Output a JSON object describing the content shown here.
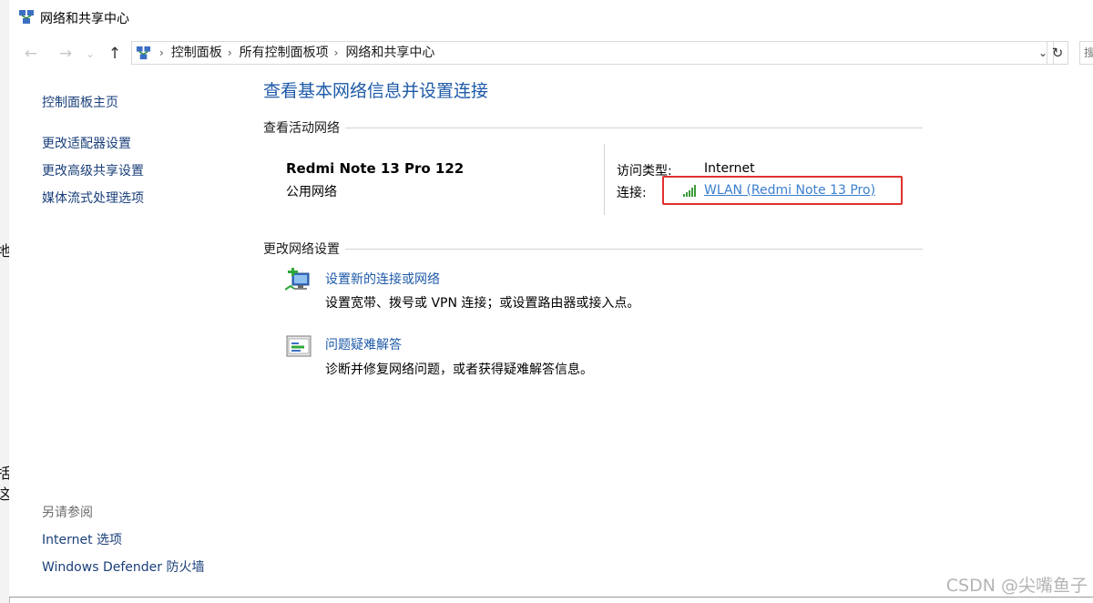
{
  "window": {
    "title": "网络和共享中心"
  },
  "nav": {
    "back": "←",
    "forward": "→",
    "recent": "⌄",
    "up": "↑",
    "refresh": "↻",
    "search_stub": "搜"
  },
  "address": {
    "crumbs": [
      "控制面板",
      "所有控制面板项",
      "网络和共享中心"
    ],
    "separator": "›",
    "dropdown": "⌄"
  },
  "sidebar": {
    "home": "控制面板主页",
    "items": [
      "更改适配器设置",
      "更改高级共享设置",
      "媒体流式处理选项"
    ],
    "see_also_label": "另请参阅",
    "see_also": [
      "Internet 选项",
      "Windows Defender 防火墙"
    ]
  },
  "main": {
    "title": "查看基本网络信息并设置连接",
    "active_label": "查看活动网络",
    "network": {
      "name": "Redmi Note 13 Pro 122",
      "category": "公用网络",
      "access_type_label": "访问类型:",
      "access_type_value": "Internet",
      "connection_label": "连接:",
      "connection_value": "WLAN (Redmi Note 13 Pro)"
    },
    "change_label": "更改网络设置",
    "tasks": [
      {
        "title": "设置新的连接或网络",
        "desc": "设置宽带、拨号或 VPN 连接；或设置路由器或接入点。",
        "icon": "new-connection-icon"
      },
      {
        "title": "问题疑难解答",
        "desc": "诊断并修复网络问题，或者获得疑难解答信息。",
        "icon": "troubleshoot-icon"
      }
    ]
  },
  "background": {
    "glyphs": [
      "地",
      "括",
      "这"
    ]
  },
  "watermark": "CSDN @尖嘴鱼子",
  "colors": {
    "link": "#1e5aa8",
    "connection_link": "#3b7fd0",
    "highlight": "#e23030"
  }
}
